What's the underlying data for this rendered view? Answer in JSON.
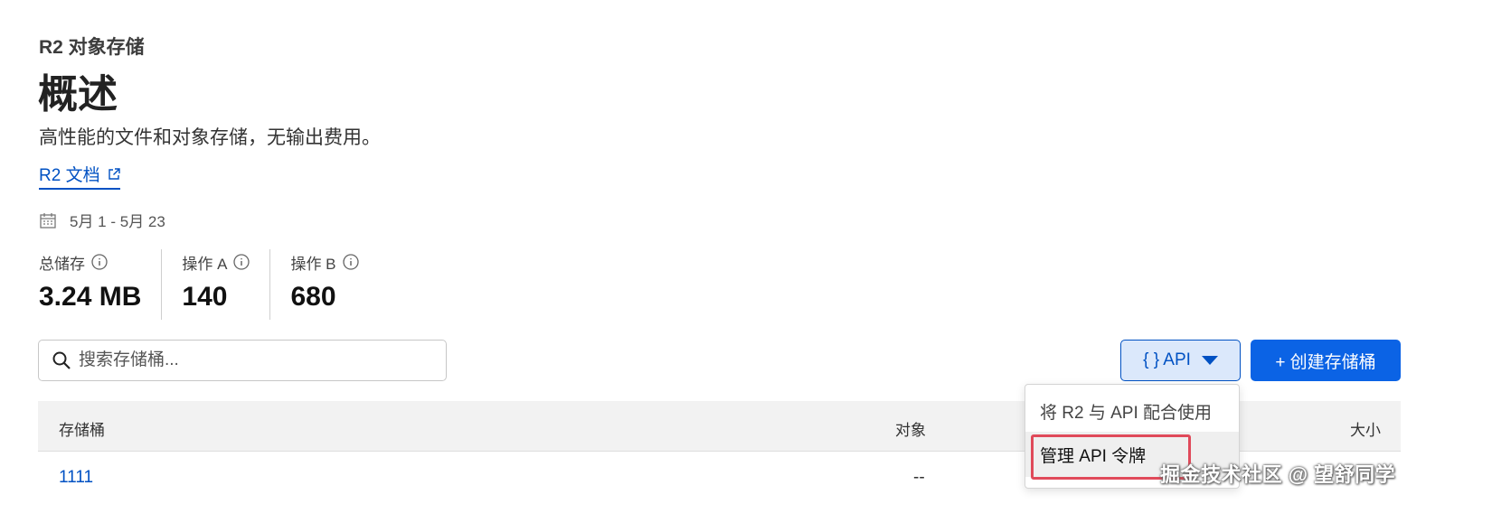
{
  "header": {
    "section": "R2 对象存储",
    "title": "概述",
    "description": "高性能的文件和对象存储，无输出费用。",
    "docs_link": "R2 文档"
  },
  "date_range": "5月 1 - 5月 23",
  "metrics": [
    {
      "label": "总储存",
      "value": "3.24 MB"
    },
    {
      "label": "操作 A",
      "value": "140"
    },
    {
      "label": "操作 B",
      "value": "680"
    }
  ],
  "search": {
    "placeholder": "搜索存储桶..."
  },
  "buttons": {
    "api": "{ } API",
    "create": "+ 创建存储桶"
  },
  "dropdown": {
    "items": [
      "将 R2 与 API 配合使用",
      "管理 API 令牌"
    ]
  },
  "table": {
    "columns": [
      "存储桶",
      "对象",
      "大小"
    ],
    "rows": [
      {
        "name": "1111",
        "objects": "--"
      }
    ]
  },
  "watermark": "掘金技术社区 @ 望舒同学",
  "colors": {
    "accent": "#0051c3",
    "primary_button": "#0b63e5",
    "highlight_border": "#e04a5a"
  }
}
